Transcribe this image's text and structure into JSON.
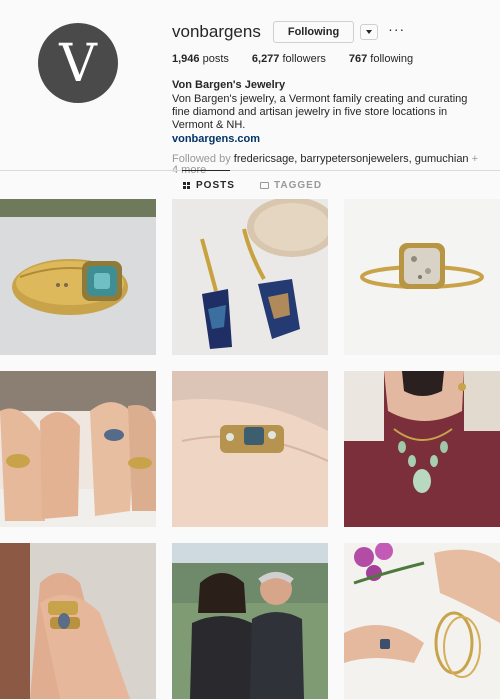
{
  "profile": {
    "avatar_letter": "V",
    "username": "vonbargens",
    "follow_button": "Following",
    "more_icon": "···",
    "stats": {
      "posts_count": "1,946",
      "posts_label": " posts",
      "followers_count": "6,277",
      "followers_label": " followers",
      "following_count": "767",
      "following_label": " following"
    },
    "full_name": "Von Bargen's Jewelry",
    "bio": "Von Bargen's jewelry, a Vermont family creating and curating fine diamond and artisan jewelry in five store locations in Vermont & NH.",
    "website": "vonbargens.com",
    "followed_by_prefix": "Followed by ",
    "followed_by_names": "fredericsage, barrypetersonjewelers, gumuchian",
    "followed_by_suffix": " + 4 more"
  },
  "tabs": {
    "posts": "POSTS",
    "tagged": "TAGGED"
  },
  "posts": [
    {
      "subject": "gold ring with blue-green stone"
    },
    {
      "subject": "blue opal drop earrings"
    },
    {
      "subject": "gold ring with grey diamond"
    },
    {
      "subject": "hands with multiple rings"
    },
    {
      "subject": "stacked rings on finger"
    },
    {
      "subject": "green stone necklace"
    },
    {
      "subject": "hand with stacked gold rings"
    },
    {
      "subject": "couple portrait outdoors"
    },
    {
      "subject": "hand with flowers and bangles"
    }
  ],
  "colors": {
    "accent_link": "#003569",
    "muted": "#999999",
    "text": "#262626"
  }
}
